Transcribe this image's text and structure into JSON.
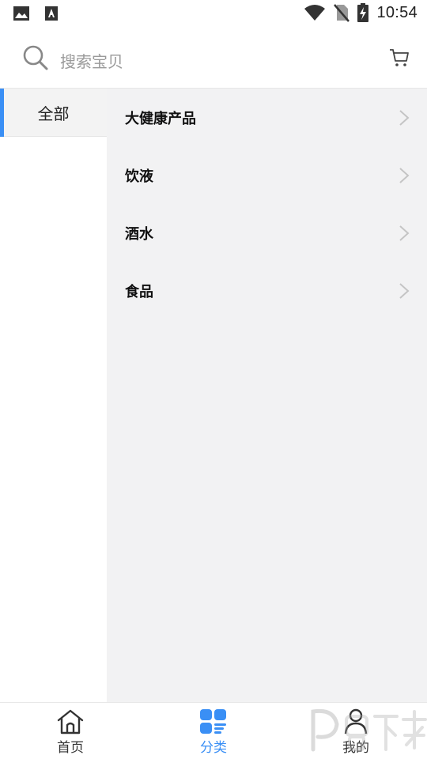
{
  "status_bar": {
    "time": "10:54",
    "icons": [
      "image-notification-icon",
      "a-notification-icon",
      "wifi-icon",
      "no-sim-icon",
      "battery-charging-icon"
    ]
  },
  "search": {
    "placeholder": "搜索宝贝"
  },
  "sidebar": {
    "items": [
      {
        "label": "全部",
        "active": true
      }
    ]
  },
  "subcategories": [
    {
      "label": "大健康产品"
    },
    {
      "label": "饮液"
    },
    {
      "label": "酒水"
    },
    {
      "label": "食品"
    }
  ],
  "tab_bar": {
    "tabs": [
      {
        "label": "首页",
        "icon": "home-icon",
        "active": false
      },
      {
        "label": "分类",
        "icon": "category-icon",
        "active": true
      },
      {
        "label": "我的",
        "icon": "user-icon",
        "active": false
      }
    ]
  },
  "colors": {
    "accent": "#3a8ff5",
    "panel_background": "#f2f2f3",
    "sidebar_active_background": "#f3f3f3",
    "placeholder": "#9a9a9a"
  }
}
